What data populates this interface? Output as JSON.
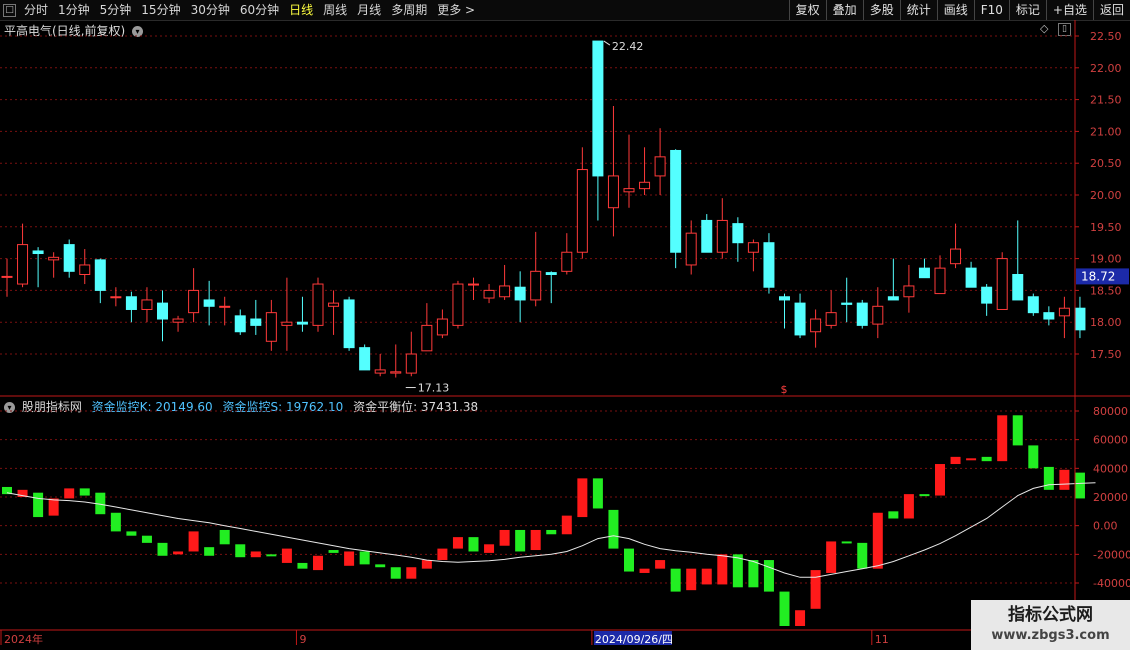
{
  "toolbar": {
    "period_tabs": [
      "分时",
      "1分钟",
      "5分钟",
      "15分钟",
      "30分钟",
      "60分钟",
      "日线",
      "周线",
      "月线",
      "多周期",
      "更多"
    ],
    "active_tab": "日线",
    "more_arrow": ">",
    "right_buttons": [
      "复权",
      "叠加",
      "多股",
      "统计",
      "画线",
      "F10",
      "标记",
      "+自选",
      "返回"
    ]
  },
  "price_panel": {
    "title": "平高电气(日线,前复权)",
    "high_label": "22.42",
    "low_label": "17.13",
    "current_price_tag": "18.72",
    "marker_symbol": "$",
    "colors": {
      "up": "#ff3a3a",
      "down": "#54ffff",
      "grid": "#7a1010",
      "axis": "#c01818"
    }
  },
  "indicator_panel": {
    "name": "股朋指标网",
    "legend_k": "资金监控K: 20149.60",
    "legend_s": "资金监控S: 19762.10",
    "legend_balance": "资金平衡位: 37431.38",
    "colors": {
      "up": "#ff1a1a",
      "down": "#22ee22",
      "line": "#e8e8e8"
    }
  },
  "date_axis": {
    "labels": [
      "2024年",
      "9",
      "2024/09/26/四",
      "11"
    ]
  },
  "watermark": {
    "title": "指标公式网",
    "url": "www.zbgs3.com"
  },
  "chart_data": [
    {
      "type": "candlestick",
      "title": "平高电气(日线,前复权)",
      "y_ticks": [
        17.5,
        18.0,
        18.5,
        19.0,
        19.5,
        20.0,
        20.5,
        21.0,
        21.5,
        22.0,
        22.5
      ],
      "ylim": [
        17.0,
        22.62
      ],
      "candles": [
        {
          "o": 18.72,
          "h": 19.0,
          "l": 18.4,
          "c": 18.72
        },
        {
          "o": 18.6,
          "h": 19.55,
          "l": 18.55,
          "c": 19.22
        },
        {
          "o": 19.12,
          "h": 19.18,
          "l": 18.55,
          "c": 19.08
        },
        {
          "o": 18.98,
          "h": 19.1,
          "l": 18.7,
          "c": 19.02
        },
        {
          "o": 19.22,
          "h": 19.3,
          "l": 18.7,
          "c": 18.8
        },
        {
          "o": 18.75,
          "h": 19.15,
          "l": 18.6,
          "c": 18.9
        },
        {
          "o": 18.98,
          "h": 19.0,
          "l": 18.3,
          "c": 18.5
        },
        {
          "o": 18.4,
          "h": 18.55,
          "l": 18.25,
          "c": 18.4
        },
        {
          "o": 18.4,
          "h": 18.48,
          "l": 18.0,
          "c": 18.2
        },
        {
          "o": 18.2,
          "h": 18.55,
          "l": 18.0,
          "c": 18.35
        },
        {
          "o": 18.3,
          "h": 18.5,
          "l": 17.7,
          "c": 18.05
        },
        {
          "o": 18.0,
          "h": 18.1,
          "l": 17.85,
          "c": 18.05
        },
        {
          "o": 18.15,
          "h": 18.85,
          "l": 18.0,
          "c": 18.5
        },
        {
          "o": 18.35,
          "h": 18.65,
          "l": 17.95,
          "c": 18.25
        },
        {
          "o": 18.25,
          "h": 18.4,
          "l": 17.95,
          "c": 18.25
        },
        {
          "o": 18.1,
          "h": 18.2,
          "l": 17.8,
          "c": 17.85
        },
        {
          "o": 18.05,
          "h": 18.35,
          "l": 17.8,
          "c": 17.95
        },
        {
          "o": 17.7,
          "h": 18.35,
          "l": 17.55,
          "c": 18.15
        },
        {
          "o": 17.95,
          "h": 18.7,
          "l": 17.55,
          "c": 18.0
        },
        {
          "o": 18.0,
          "h": 18.4,
          "l": 17.85,
          "c": 17.97
        },
        {
          "o": 17.95,
          "h": 18.7,
          "l": 17.85,
          "c": 18.6
        },
        {
          "o": 18.25,
          "h": 18.5,
          "l": 17.8,
          "c": 18.3
        },
        {
          "o": 18.35,
          "h": 18.4,
          "l": 17.55,
          "c": 17.6
        },
        {
          "o": 17.6,
          "h": 17.65,
          "l": 17.25,
          "c": 17.25
        },
        {
          "o": 17.2,
          "h": 17.5,
          "l": 17.15,
          "c": 17.25
        },
        {
          "o": 17.2,
          "h": 17.65,
          "l": 17.13,
          "c": 17.22
        },
        {
          "o": 17.2,
          "h": 17.85,
          "l": 17.15,
          "c": 17.5
        },
        {
          "o": 17.55,
          "h": 18.3,
          "l": 17.55,
          "c": 17.95
        },
        {
          "o": 17.8,
          "h": 18.2,
          "l": 17.75,
          "c": 18.05
        },
        {
          "o": 17.95,
          "h": 18.65,
          "l": 17.9,
          "c": 18.6
        },
        {
          "o": 18.6,
          "h": 18.7,
          "l": 18.35,
          "c": 18.6
        },
        {
          "o": 18.38,
          "h": 18.6,
          "l": 18.3,
          "c": 18.5
        },
        {
          "o": 18.4,
          "h": 18.9,
          "l": 18.35,
          "c": 18.57
        },
        {
          "o": 18.55,
          "h": 18.8,
          "l": 18.0,
          "c": 18.35
        },
        {
          "o": 18.35,
          "h": 19.42,
          "l": 18.25,
          "c": 18.8
        },
        {
          "o": 18.78,
          "h": 18.8,
          "l": 18.3,
          "c": 18.75
        },
        {
          "o": 18.8,
          "h": 19.4,
          "l": 18.75,
          "c": 19.1
        },
        {
          "o": 19.1,
          "h": 20.75,
          "l": 19.0,
          "c": 20.4
        },
        {
          "o": 22.42,
          "h": 22.42,
          "l": 19.6,
          "c": 20.3
        },
        {
          "o": 19.8,
          "h": 21.4,
          "l": 19.35,
          "c": 20.3
        },
        {
          "o": 20.05,
          "h": 20.95,
          "l": 19.8,
          "c": 20.1
        },
        {
          "o": 20.1,
          "h": 20.75,
          "l": 20.0,
          "c": 20.2
        },
        {
          "o": 20.3,
          "h": 21.05,
          "l": 20.0,
          "c": 20.6
        },
        {
          "o": 20.7,
          "h": 20.72,
          "l": 18.85,
          "c": 19.1
        },
        {
          "o": 18.9,
          "h": 19.6,
          "l": 18.75,
          "c": 19.4
        },
        {
          "o": 19.6,
          "h": 19.7,
          "l": 19.1,
          "c": 19.1
        },
        {
          "o": 19.1,
          "h": 19.95,
          "l": 19.0,
          "c": 19.6
        },
        {
          "o": 19.55,
          "h": 19.65,
          "l": 18.95,
          "c": 19.25
        },
        {
          "o": 19.1,
          "h": 19.3,
          "l": 18.8,
          "c": 19.25
        },
        {
          "o": 19.25,
          "h": 19.4,
          "l": 18.45,
          "c": 18.55
        },
        {
          "o": 18.4,
          "h": 18.45,
          "l": 17.9,
          "c": 18.35
        },
        {
          "o": 18.3,
          "h": 18.45,
          "l": 17.75,
          "c": 17.8
        },
        {
          "o": 17.85,
          "h": 18.2,
          "l": 17.6,
          "c": 18.05
        },
        {
          "o": 17.95,
          "h": 18.5,
          "l": 17.9,
          "c": 18.15
        },
        {
          "o": 18.3,
          "h": 18.7,
          "l": 18.0,
          "c": 18.28
        },
        {
          "o": 18.3,
          "h": 18.35,
          "l": 17.9,
          "c": 17.95
        },
        {
          "o": 17.97,
          "h": 18.55,
          "l": 17.75,
          "c": 18.25
        },
        {
          "o": 18.4,
          "h": 19.0,
          "l": 18.35,
          "c": 18.35
        },
        {
          "o": 18.4,
          "h": 18.9,
          "l": 18.15,
          "c": 18.57
        },
        {
          "o": 18.85,
          "h": 19.0,
          "l": 18.8,
          "c": 18.7
        },
        {
          "o": 18.45,
          "h": 19.05,
          "l": 18.45,
          "c": 18.85
        },
        {
          "o": 18.92,
          "h": 19.55,
          "l": 18.85,
          "c": 19.15
        },
        {
          "o": 18.85,
          "h": 18.95,
          "l": 18.55,
          "c": 18.55
        },
        {
          "o": 18.55,
          "h": 18.6,
          "l": 18.1,
          "c": 18.3
        },
        {
          "o": 18.2,
          "h": 19.1,
          "l": 18.2,
          "c": 19.0
        },
        {
          "o": 18.75,
          "h": 19.6,
          "l": 18.4,
          "c": 18.35
        },
        {
          "o": 18.4,
          "h": 18.45,
          "l": 18.1,
          "c": 18.15
        },
        {
          "o": 18.15,
          "h": 18.25,
          "l": 17.95,
          "c": 18.05
        },
        {
          "o": 18.1,
          "h": 18.4,
          "l": 17.75,
          "c": 18.22
        },
        {
          "o": 18.22,
          "h": 18.4,
          "l": 17.75,
          "c": 17.88
        }
      ]
    },
    {
      "type": "bar",
      "title": "股朋指标网",
      "y_ticks": [
        -40000,
        -20000,
        0,
        20000,
        40000,
        60000,
        80000
      ],
      "ylim": [
        -72000,
        88000
      ],
      "bars": [
        {
          "t": 27000,
          "b": 22000,
          "up": false
        },
        {
          "t": 25000,
          "b": 20000,
          "up": true
        },
        {
          "t": 23000,
          "b": 6000,
          "up": false
        },
        {
          "t": 19000,
          "b": 7000,
          "up": true
        },
        {
          "t": 26000,
          "b": 19000,
          "up": true
        },
        {
          "t": 26000,
          "b": 21000,
          "up": false
        },
        {
          "t": 23000,
          "b": 8000,
          "up": false
        },
        {
          "t": 9000,
          "b": -4000,
          "up": false
        },
        {
          "t": -4000,
          "b": -7000,
          "up": false
        },
        {
          "t": -7000,
          "b": -12000,
          "up": false
        },
        {
          "t": -12000,
          "b": -21000,
          "up": false
        },
        {
          "t": -18000,
          "b": -20000,
          "up": true
        },
        {
          "t": -4000,
          "b": -18000,
          "up": true
        },
        {
          "t": -21000,
          "b": -15000,
          "up": false
        },
        {
          "t": -3000,
          "b": -13000,
          "up": false
        },
        {
          "t": -13000,
          "b": -22000,
          "up": false
        },
        {
          "t": -18000,
          "b": -22000,
          "up": true
        },
        {
          "t": -20000,
          "b": -21000,
          "up": false
        },
        {
          "t": -16000,
          "b": -26000,
          "up": true
        },
        {
          "t": -26000,
          "b": -30000,
          "up": false
        },
        {
          "t": -21000,
          "b": -31000,
          "up": true
        },
        {
          "t": -17000,
          "b": -19000,
          "up": false
        },
        {
          "t": -18000,
          "b": -28000,
          "up": true
        },
        {
          "t": -18000,
          "b": -27000,
          "up": false
        },
        {
          "t": -27000,
          "b": -29000,
          "up": false
        },
        {
          "t": -29000,
          "b": -37000,
          "up": false
        },
        {
          "t": -29000,
          "b": -37000,
          "up": true
        },
        {
          "t": -24000,
          "b": -30000,
          "up": true
        },
        {
          "t": -16000,
          "b": -24000,
          "up": true
        },
        {
          "t": -8000,
          "b": -16000,
          "up": true
        },
        {
          "t": -8000,
          "b": -18000,
          "up": false
        },
        {
          "t": -13000,
          "b": -19000,
          "up": true
        },
        {
          "t": -3000,
          "b": -14000,
          "up": true
        },
        {
          "t": -3000,
          "b": -18000,
          "up": false
        },
        {
          "t": -3000,
          "b": -17000,
          "up": true
        },
        {
          "t": -3000,
          "b": -6000,
          "up": false
        },
        {
          "t": 7000,
          "b": -6000,
          "up": true
        },
        {
          "t": 33000,
          "b": 6000,
          "up": true
        },
        {
          "t": 33000,
          "b": 12000,
          "up": false
        },
        {
          "t": 11000,
          "b": -16000,
          "up": false
        },
        {
          "t": -16000,
          "b": -32000,
          "up": false
        },
        {
          "t": -30000,
          "b": -33000,
          "up": true
        },
        {
          "t": -24000,
          "b": -30000,
          "up": true
        },
        {
          "t": -30000,
          "b": -46000,
          "up": false
        },
        {
          "t": -30000,
          "b": -45000,
          "up": true
        },
        {
          "t": -30000,
          "b": -41000,
          "up": true
        },
        {
          "t": -20000,
          "b": -41000,
          "up": true
        },
        {
          "t": -20000,
          "b": -43000,
          "up": false
        },
        {
          "t": -24000,
          "b": -43000,
          "up": false
        },
        {
          "t": -24000,
          "b": -46000,
          "up": false
        },
        {
          "t": -46000,
          "b": -70000,
          "up": false
        },
        {
          "t": -59000,
          "b": -70000,
          "up": true
        },
        {
          "t": -31000,
          "b": -58000,
          "up": true
        },
        {
          "t": -11000,
          "b": -33000,
          "up": true
        },
        {
          "t": -11000,
          "b": -12000,
          "up": false
        },
        {
          "t": -12000,
          "b": -30000,
          "up": false
        },
        {
          "t": 9000,
          "b": -30000,
          "up": true
        },
        {
          "t": 10000,
          "b": 5000,
          "up": false
        },
        {
          "t": 22000,
          "b": 5000,
          "up": true
        },
        {
          "t": 22000,
          "b": 21000,
          "up": false
        },
        {
          "t": 43000,
          "b": 21000,
          "up": true
        },
        {
          "t": 48000,
          "b": 43000,
          "up": true
        },
        {
          "t": 47000,
          "b": 46000,
          "up": true
        },
        {
          "t": 48000,
          "b": 45000,
          "up": false
        },
        {
          "t": 77000,
          "b": 45000,
          "up": true
        },
        {
          "t": 77000,
          "b": 56000,
          "up": false
        },
        {
          "t": 56000,
          "b": 40000,
          "up": false
        },
        {
          "t": 41000,
          "b": 25000,
          "up": false
        },
        {
          "t": 39000,
          "b": 25000,
          "up": true
        },
        {
          "t": 37000,
          "b": 19000,
          "up": false
        }
      ],
      "line_S": [
        23000,
        21000,
        19000,
        18000,
        17500,
        16500,
        15000,
        13000,
        11000,
        9000,
        7000,
        5000,
        3500,
        2000,
        0,
        -2000,
        -4000,
        -6000,
        -8000,
        -10000,
        -12000,
        -14000,
        -16000,
        -17500,
        -19000,
        -20500,
        -22000,
        -24000,
        -25000,
        -25500,
        -25000,
        -24500,
        -23500,
        -22000,
        -21000,
        -20000,
        -18000,
        -14000,
        -9000,
        -7000,
        -9000,
        -13000,
        -16000,
        -17500,
        -18500,
        -20000,
        -21000,
        -22500,
        -25000,
        -29000,
        -33000,
        -36000,
        -36000,
        -34000,
        -32000,
        -30000,
        -28000,
        -25000,
        -21000,
        -17000,
        -12500,
        -7000,
        -1000,
        5000,
        13000,
        21000,
        26000,
        28500,
        29000,
        29500,
        30000
      ]
    }
  ]
}
